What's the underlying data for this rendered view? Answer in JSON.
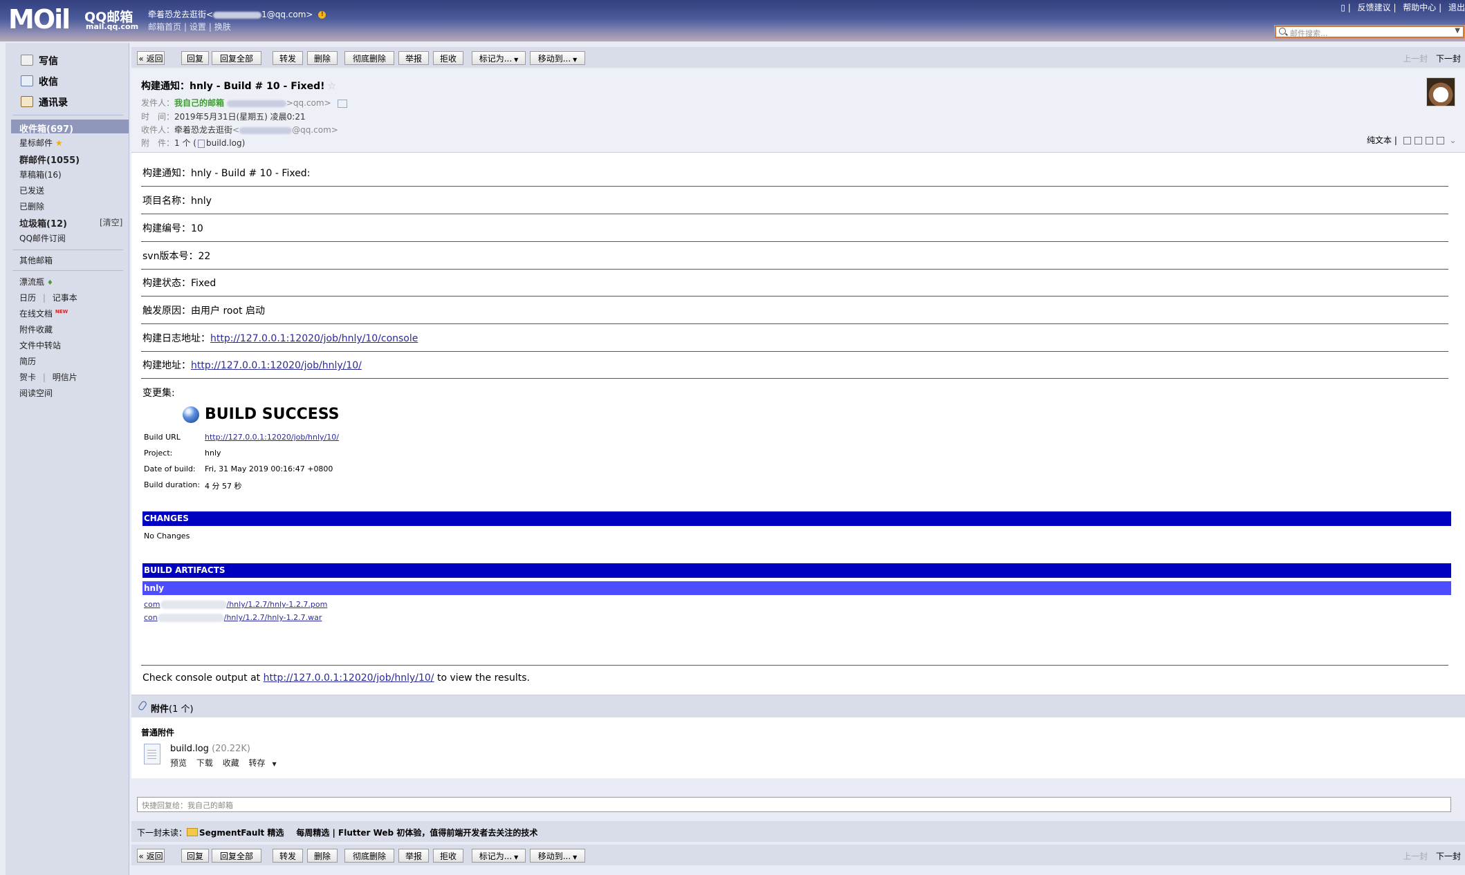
{
  "topbar": {
    "logo": "MOil",
    "brand": "QQ邮箱",
    "domain": "mail.qq.com",
    "user_name": "牵着恐龙去逛街",
    "user_email_open": "<",
    "user_email_suffix": "1@qq.com>",
    "links": [
      "邮箱首页",
      "设置",
      "换肤"
    ],
    "right_links": [
      "反馈建议",
      "帮助中心",
      "退出"
    ],
    "search_placeholder": "邮件搜索..."
  },
  "sidebar": {
    "main": [
      {
        "label": "写信",
        "icon": "compose-icon"
      },
      {
        "label": "收信",
        "icon": "inbox-icon"
      },
      {
        "label": "通讯录",
        "icon": "contacts-icon"
      }
    ],
    "folders": [
      {
        "label": "收件箱(697)",
        "bold": true
      },
      {
        "label": "星标邮件",
        "bold": false
      },
      {
        "label": "群邮件(1055)",
        "bold": true
      },
      {
        "label": "草稿箱(16)",
        "bold": false
      },
      {
        "label": "已发送",
        "bold": false
      },
      {
        "label": "已删除",
        "bold": false
      },
      {
        "label": "垃圾箱(12)",
        "bold": true
      },
      {
        "label": "QQ邮件订阅",
        "bold": false
      }
    ],
    "clear_label": "[清空]",
    "other_mailbox": "其他邮箱",
    "apps": {
      "drift_bottle": "漂流瓶",
      "calendar": "日历",
      "notebook": "记事本",
      "online_docs": "在线文档",
      "new_badge": "NEW",
      "attachment_favorites": "附件收藏",
      "file_transfer": "文件中转站",
      "resume": "简历",
      "greeting_card": "贺卡",
      "postcard": "明信片",
      "reading_space": "阅读空间"
    }
  },
  "toolbar": {
    "back": "« 返回",
    "reply": "回复",
    "reply_all": "回复全部",
    "forward": "转发",
    "delete": "删除",
    "delete_permanently": "彻底删除",
    "report": "举报",
    "reject": "拒收",
    "mark_as": "标记为...",
    "move_to": "移动到...",
    "prev": "上一封",
    "next": "下一封"
  },
  "mail": {
    "subject": "构建通知：hnly - Build # 10 - Fixed!",
    "from_label": "发件人：",
    "from_name": "我自己的邮箱",
    "from_email_suffix": ">qq.com>",
    "time_label": "时　间：",
    "time_value": "2019年5月31日(星期五) 凌晨0:21",
    "to_label": "收件人：",
    "to_name": "牵着恐龙去逛街",
    "to_email_open": "<",
    "to_email_suffix": "@qq.com>",
    "attach_label": "附　件：",
    "attach_value": "1 个 (",
    "attach_file": "build.log",
    "attach_close": ")",
    "plain_text": "纯文本"
  },
  "body": {
    "lines": [
      {
        "text": "构建通知：hnly - Build # 10 - Fixed:"
      },
      {
        "text": "项目名称：hnly"
      },
      {
        "text": "构建编号：10"
      },
      {
        "text": "svn版本号：22"
      },
      {
        "text": "构建状态：Fixed"
      },
      {
        "text": "触发原因：由用户 root 启动"
      }
    ],
    "log_label": "构建日志地址：",
    "log_url": "http://127.0.0.1:12020/job/hnly/10/console",
    "build_label": "构建地址：",
    "build_url": "http://127.0.0.1:12020/job/hnly/10/",
    "changeset_label": "变更集:",
    "build_status": "BUILD SUCCESS",
    "details": [
      {
        "label": "Build URL",
        "value": "http://127.0.0.1:12020/job/hnly/10/"
      },
      {
        "label": "Project:",
        "value": "hnly"
      },
      {
        "label": "Date of build:",
        "value": "Fri, 31 May 2019 00:16:47 +0800"
      },
      {
        "label": "Build duration:",
        "value": "4 分 57 秒"
      }
    ],
    "changes_header": "CHANGES",
    "no_changes": "No Changes",
    "artifacts_header": "BUILD ARTIFACTS",
    "artifact_project": "hnly",
    "artifacts": [
      {
        "prefix": "com",
        "suffix": "/hnly/1.2.7/hnly-1.2.7.pom"
      },
      {
        "prefix": "con",
        "suffix": "/hnly/1.2.7/hnly-1.2.7.war"
      }
    ],
    "console_prefix": "Check console output at ",
    "console_url": "http://127.0.0.1:12020/job/hnly/10/",
    "console_suffix": " to view the results."
  },
  "attachments": {
    "title": "附件",
    "count": "(1 个)",
    "section": "普通附件",
    "file_name": "build.log",
    "file_size": "(20.22K)",
    "actions": [
      "预览",
      "下载",
      "收藏",
      "转存"
    ]
  },
  "quick_reply_placeholder": "快捷回复给：我自己的邮箱",
  "next_unread": {
    "label": "下一封未读：",
    "sender": "SegmentFault 精选",
    "subject": "每周精选 | Flutter Web 初体验，值得前端开发者去关注的技术"
  }
}
